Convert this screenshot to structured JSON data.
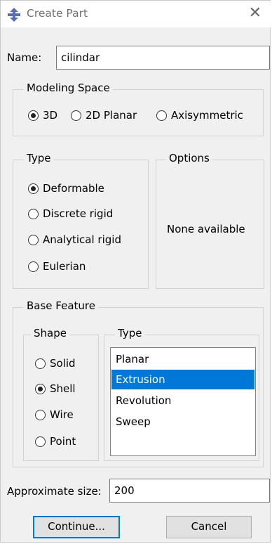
{
  "window": {
    "title": "Create Part",
    "close_icon": "close-icon"
  },
  "name": {
    "label": "Name:",
    "value": "cilindar"
  },
  "modeling_space": {
    "legend": "Modeling Space",
    "options": [
      "3D",
      "2D Planar",
      "Axisymmetric"
    ],
    "selected": "3D"
  },
  "type": {
    "legend": "Type",
    "options": [
      "Deformable",
      "Discrete rigid",
      "Analytical rigid",
      "Eulerian"
    ],
    "selected": "Deformable"
  },
  "options": {
    "legend": "Options",
    "text": "None available"
  },
  "base_feature": {
    "legend": "Base Feature",
    "shape": {
      "legend": "Shape",
      "options": [
        "Solid",
        "Shell",
        "Wire",
        "Point"
      ],
      "selected": "Shell"
    },
    "type": {
      "legend": "Type",
      "items": [
        "Planar",
        "Extrusion",
        "Revolution",
        "Sweep"
      ],
      "selected": "Extrusion"
    }
  },
  "approx_size": {
    "label": "Approximate size:",
    "value": "200"
  },
  "buttons": {
    "continue": "Continue...",
    "cancel": "Cancel"
  },
  "colors": {
    "selection": "#0078d7",
    "dialog_bg": "#f0f0f0"
  }
}
